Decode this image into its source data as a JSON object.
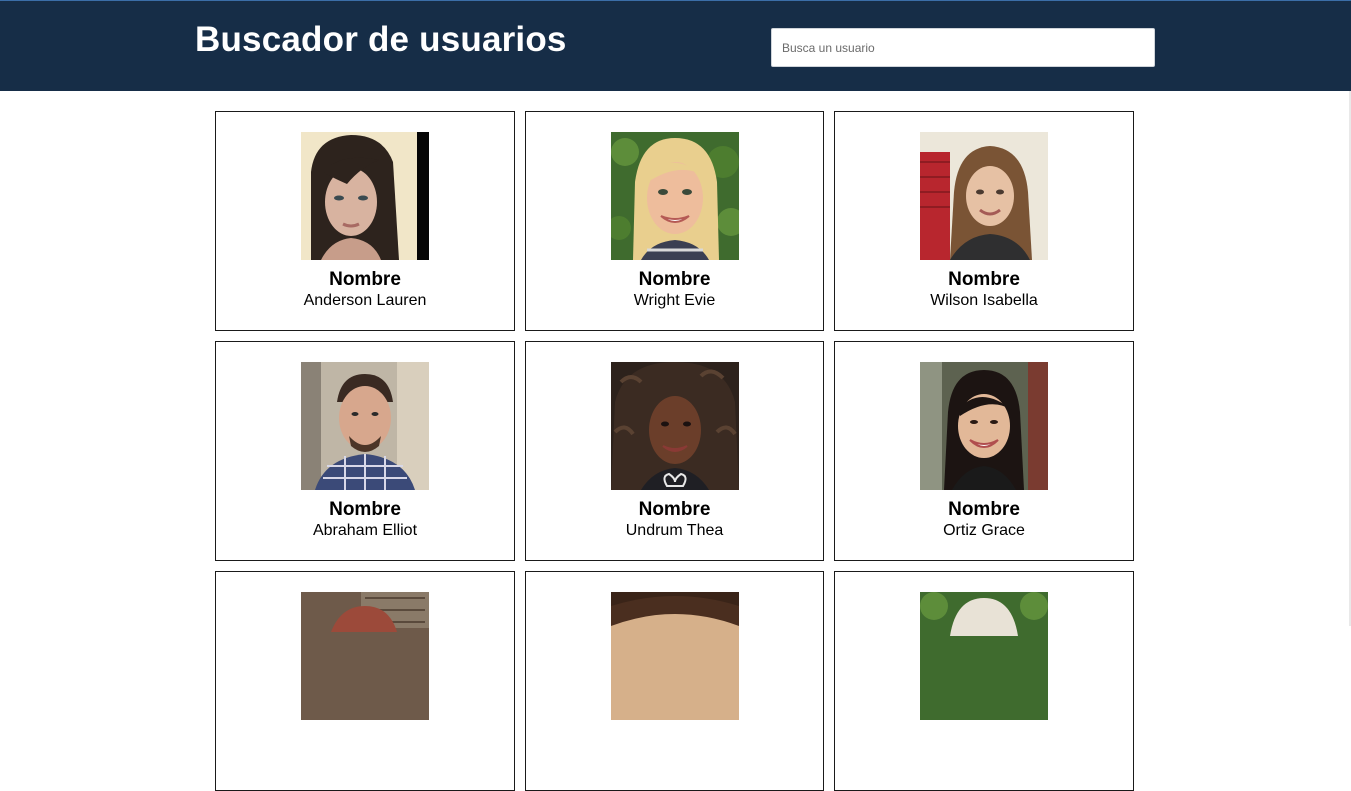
{
  "header": {
    "title": "Buscador de usuarios",
    "background": "#162d47",
    "search": {
      "placeholder": "Busca un usuario",
      "value": ""
    }
  },
  "users": [
    {
      "label": "Nombre",
      "name": "Anderson Lauren",
      "photo": "avatar-photo"
    },
    {
      "label": "Nombre",
      "name": "Wright Evie",
      "photo": "avatar-photo"
    },
    {
      "label": "Nombre",
      "name": "Wilson Isabella",
      "photo": "avatar-photo"
    },
    {
      "label": "Nombre",
      "name": "Abraham Elliot",
      "photo": "avatar-photo"
    },
    {
      "label": "Nombre",
      "name": "Undrum Thea",
      "photo": "avatar-photo"
    },
    {
      "label": "Nombre",
      "name": "Ortiz Grace",
      "photo": "avatar-photo"
    },
    {
      "label": "",
      "name": "",
      "photo": "avatar-photo"
    },
    {
      "label": "",
      "name": "",
      "photo": "avatar-photo"
    },
    {
      "label": "",
      "name": "",
      "photo": "avatar-photo"
    }
  ]
}
